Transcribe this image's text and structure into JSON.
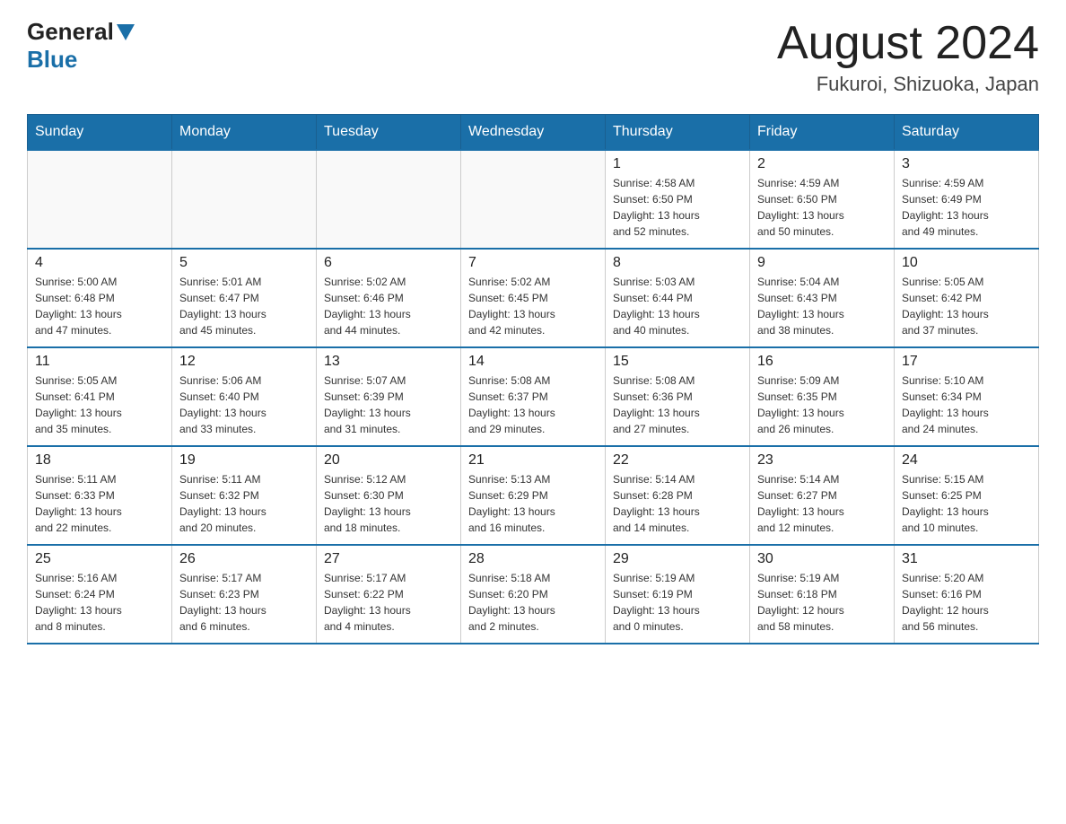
{
  "header": {
    "logo_general": "General",
    "logo_blue": "Blue",
    "main_title": "August 2024",
    "subtitle": "Fukuroi, Shizuoka, Japan"
  },
  "days_of_week": [
    "Sunday",
    "Monday",
    "Tuesday",
    "Wednesday",
    "Thursday",
    "Friday",
    "Saturday"
  ],
  "weeks": [
    [
      {
        "day": "",
        "info": ""
      },
      {
        "day": "",
        "info": ""
      },
      {
        "day": "",
        "info": ""
      },
      {
        "day": "",
        "info": ""
      },
      {
        "day": "1",
        "info": "Sunrise: 4:58 AM\nSunset: 6:50 PM\nDaylight: 13 hours\nand 52 minutes."
      },
      {
        "day": "2",
        "info": "Sunrise: 4:59 AM\nSunset: 6:50 PM\nDaylight: 13 hours\nand 50 minutes."
      },
      {
        "day": "3",
        "info": "Sunrise: 4:59 AM\nSunset: 6:49 PM\nDaylight: 13 hours\nand 49 minutes."
      }
    ],
    [
      {
        "day": "4",
        "info": "Sunrise: 5:00 AM\nSunset: 6:48 PM\nDaylight: 13 hours\nand 47 minutes."
      },
      {
        "day": "5",
        "info": "Sunrise: 5:01 AM\nSunset: 6:47 PM\nDaylight: 13 hours\nand 45 minutes."
      },
      {
        "day": "6",
        "info": "Sunrise: 5:02 AM\nSunset: 6:46 PM\nDaylight: 13 hours\nand 44 minutes."
      },
      {
        "day": "7",
        "info": "Sunrise: 5:02 AM\nSunset: 6:45 PM\nDaylight: 13 hours\nand 42 minutes."
      },
      {
        "day": "8",
        "info": "Sunrise: 5:03 AM\nSunset: 6:44 PM\nDaylight: 13 hours\nand 40 minutes."
      },
      {
        "day": "9",
        "info": "Sunrise: 5:04 AM\nSunset: 6:43 PM\nDaylight: 13 hours\nand 38 minutes."
      },
      {
        "day": "10",
        "info": "Sunrise: 5:05 AM\nSunset: 6:42 PM\nDaylight: 13 hours\nand 37 minutes."
      }
    ],
    [
      {
        "day": "11",
        "info": "Sunrise: 5:05 AM\nSunset: 6:41 PM\nDaylight: 13 hours\nand 35 minutes."
      },
      {
        "day": "12",
        "info": "Sunrise: 5:06 AM\nSunset: 6:40 PM\nDaylight: 13 hours\nand 33 minutes."
      },
      {
        "day": "13",
        "info": "Sunrise: 5:07 AM\nSunset: 6:39 PM\nDaylight: 13 hours\nand 31 minutes."
      },
      {
        "day": "14",
        "info": "Sunrise: 5:08 AM\nSunset: 6:37 PM\nDaylight: 13 hours\nand 29 minutes."
      },
      {
        "day": "15",
        "info": "Sunrise: 5:08 AM\nSunset: 6:36 PM\nDaylight: 13 hours\nand 27 minutes."
      },
      {
        "day": "16",
        "info": "Sunrise: 5:09 AM\nSunset: 6:35 PM\nDaylight: 13 hours\nand 26 minutes."
      },
      {
        "day": "17",
        "info": "Sunrise: 5:10 AM\nSunset: 6:34 PM\nDaylight: 13 hours\nand 24 minutes."
      }
    ],
    [
      {
        "day": "18",
        "info": "Sunrise: 5:11 AM\nSunset: 6:33 PM\nDaylight: 13 hours\nand 22 minutes."
      },
      {
        "day": "19",
        "info": "Sunrise: 5:11 AM\nSunset: 6:32 PM\nDaylight: 13 hours\nand 20 minutes."
      },
      {
        "day": "20",
        "info": "Sunrise: 5:12 AM\nSunset: 6:30 PM\nDaylight: 13 hours\nand 18 minutes."
      },
      {
        "day": "21",
        "info": "Sunrise: 5:13 AM\nSunset: 6:29 PM\nDaylight: 13 hours\nand 16 minutes."
      },
      {
        "day": "22",
        "info": "Sunrise: 5:14 AM\nSunset: 6:28 PM\nDaylight: 13 hours\nand 14 minutes."
      },
      {
        "day": "23",
        "info": "Sunrise: 5:14 AM\nSunset: 6:27 PM\nDaylight: 13 hours\nand 12 minutes."
      },
      {
        "day": "24",
        "info": "Sunrise: 5:15 AM\nSunset: 6:25 PM\nDaylight: 13 hours\nand 10 minutes."
      }
    ],
    [
      {
        "day": "25",
        "info": "Sunrise: 5:16 AM\nSunset: 6:24 PM\nDaylight: 13 hours\nand 8 minutes."
      },
      {
        "day": "26",
        "info": "Sunrise: 5:17 AM\nSunset: 6:23 PM\nDaylight: 13 hours\nand 6 minutes."
      },
      {
        "day": "27",
        "info": "Sunrise: 5:17 AM\nSunset: 6:22 PM\nDaylight: 13 hours\nand 4 minutes."
      },
      {
        "day": "28",
        "info": "Sunrise: 5:18 AM\nSunset: 6:20 PM\nDaylight: 13 hours\nand 2 minutes."
      },
      {
        "day": "29",
        "info": "Sunrise: 5:19 AM\nSunset: 6:19 PM\nDaylight: 13 hours\nand 0 minutes."
      },
      {
        "day": "30",
        "info": "Sunrise: 5:19 AM\nSunset: 6:18 PM\nDaylight: 12 hours\nand 58 minutes."
      },
      {
        "day": "31",
        "info": "Sunrise: 5:20 AM\nSunset: 6:16 PM\nDaylight: 12 hours\nand 56 minutes."
      }
    ]
  ]
}
